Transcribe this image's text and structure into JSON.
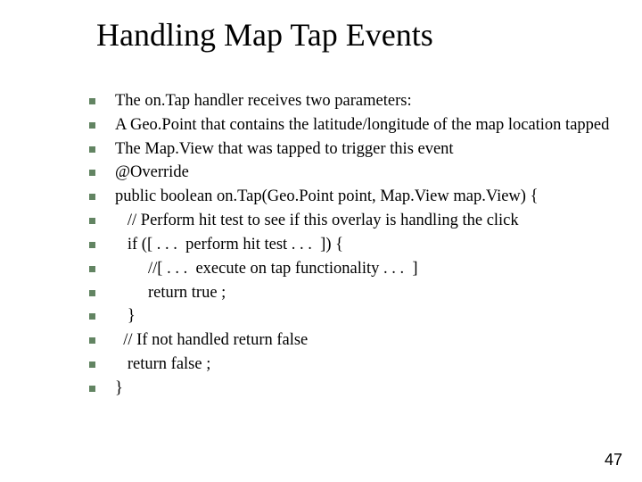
{
  "title": "Handling Map Tap Events",
  "lines": [
    "The on.Tap handler receives two parameters:",
    "A Geo.Point that contains the latitude/longitude of the map location tapped",
    "The Map.View that was tapped to trigger this event",
    "@Override",
    "public boolean on.Tap(Geo.Point point, Map.View map.View) {",
    "   // Perform hit test to see if this overlay is handling the click",
    "   if ([ . . .  perform hit test . . .  ]) {",
    "        //[ . . .  execute on tap functionality . . .  ]",
    "        return true ;",
    "   }",
    "  // If not handled return false",
    "   return false ;",
    "}"
  ],
  "page_number": "47"
}
